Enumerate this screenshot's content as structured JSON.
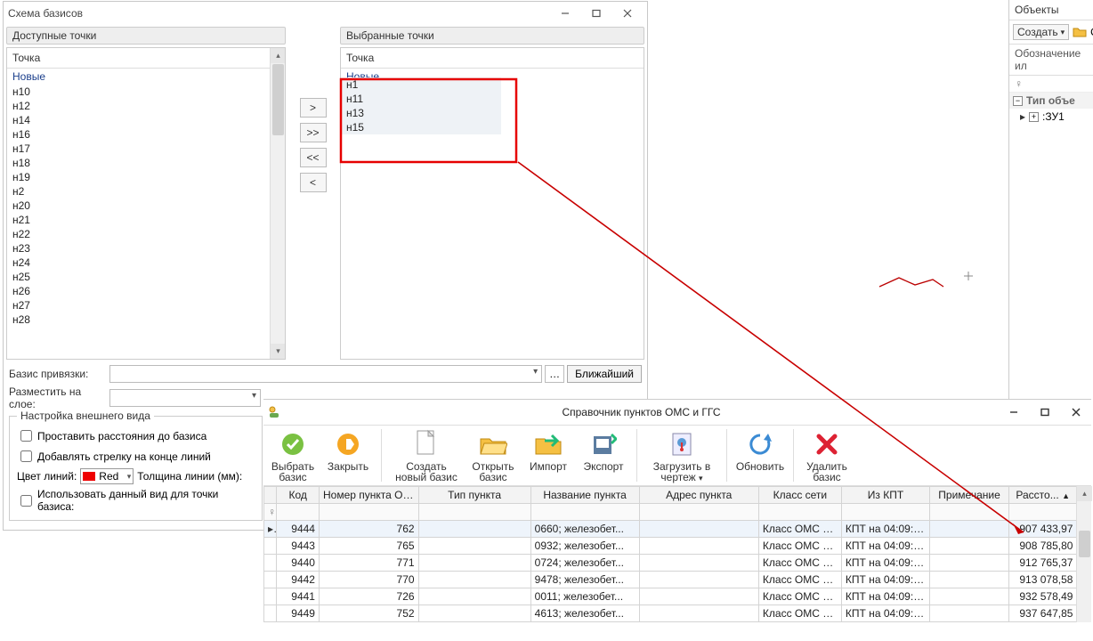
{
  "basis_window": {
    "title": "Схема базисов",
    "available_title": "Доступные точки",
    "selected_title": "Выбранные точки",
    "point_header": "Точка",
    "category": "Новые",
    "available_points": [
      "н10",
      "н12",
      "н14",
      "н16",
      "н17",
      "н18",
      "н19",
      "н2",
      "н20",
      "н21",
      "н22",
      "н23",
      "н24",
      "н25",
      "н26",
      "н27",
      "н28"
    ],
    "selected_points": [
      "н1",
      "н11",
      "н13",
      "н15"
    ],
    "move_right": ">",
    "move_all_right": ">>",
    "move_all_left": "<<",
    "move_left": "<",
    "basis_label": "Базис привязки:",
    "layer_label": "Разместить на слое:",
    "nearest_btn": "Ближайший",
    "appearance": {
      "legend": "Настройка внешнего вида",
      "distance_check": "Проставить расстояния до базиса",
      "arrow_check": "Добавлять стрелку на конце линий",
      "color_label": "Цвет линий:",
      "color_name": "Red",
      "thickness_label": "Толщина линии (мм):",
      "use_view_check": "Использовать данный вид для точки базиса:"
    }
  },
  "objects_panel": {
    "title": "Объекты",
    "create_btn": "Создать",
    "open_btn": "От",
    "header": "Обозначение ил",
    "type_header": "Тип объе",
    "object": ":ЗУ1"
  },
  "directory": {
    "title": "Справочник пунктов ОМС и ГГС",
    "toolbar": {
      "select": "Выбрать базис",
      "close": "Закрыть",
      "create": "Создать новый базис",
      "open": "Открыть базис",
      "import": "Импорт",
      "export": "Экспорт",
      "load": "Загрузить в чертеж",
      "refresh": "Обновить",
      "delete": "Удалить базис"
    },
    "columns": [
      "Код",
      "Номер пункта ОМС",
      "Тип пункта",
      "Название пункта",
      "Адрес пункта",
      "Класс сети",
      "Из КПТ",
      "Примечание",
      "Рассто..."
    ],
    "rows": [
      {
        "code": "9444",
        "num": "762",
        "type": "",
        "name": "0660; железобет...",
        "addr": "",
        "class": "Класс ОМС – ...",
        "kpt": "КПТ на 04:09:0...",
        "note": "",
        "dist": "907 433,97"
      },
      {
        "code": "9443",
        "num": "765",
        "type": "",
        "name": "0932; железобет...",
        "addr": "",
        "class": "Класс ОМС – ...",
        "kpt": "КПТ на 04:09:0...",
        "note": "",
        "dist": "908 785,80"
      },
      {
        "code": "9440",
        "num": "771",
        "type": "",
        "name": "0724; железобет...",
        "addr": "",
        "class": "Класс ОМС – ...",
        "kpt": "КПТ на 04:09:0...",
        "note": "",
        "dist": "912 765,37"
      },
      {
        "code": "9442",
        "num": "770",
        "type": "",
        "name": "9478; железобет...",
        "addr": "",
        "class": "Класс ОМС – ...",
        "kpt": "КПТ на 04:09:0...",
        "note": "",
        "dist": "913 078,58"
      },
      {
        "code": "9441",
        "num": "726",
        "type": "",
        "name": "0011; железобет...",
        "addr": "",
        "class": "Класс ОМС – ...",
        "kpt": "КПТ на 04:09:0...",
        "note": "",
        "dist": "932 578,49"
      },
      {
        "code": "9449",
        "num": "752",
        "type": "",
        "name": "4613; железобет...",
        "addr": "",
        "class": "Класс ОМС – ...",
        "kpt": "КПТ на 04:09:0...",
        "note": "",
        "dist": "937 647,85"
      }
    ]
  },
  "icons": {
    "folder": "📁"
  }
}
